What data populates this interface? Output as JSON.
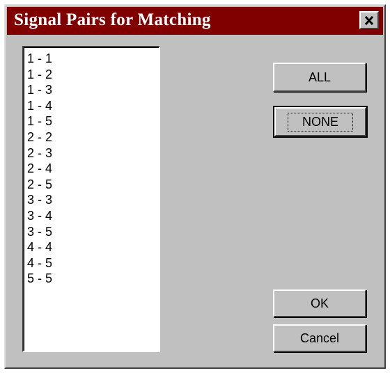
{
  "window": {
    "title": "Signal Pairs for Matching"
  },
  "titlebar": {
    "close_icon": "close-x-icon"
  },
  "signal_pairs": {
    "items": [
      "1 - 1",
      "1 - 2",
      "1 - 3",
      "1 - 4",
      "1 - 5",
      "2 - 2",
      "2 - 3",
      "2 - 4",
      "2 - 5",
      "3 - 3",
      "3 - 4",
      "3 - 5",
      "4 - 4",
      "4 - 5",
      "5 - 5"
    ]
  },
  "buttons": {
    "all": "ALL",
    "none": "NONE",
    "ok": "OK",
    "cancel": "Cancel"
  },
  "colors": {
    "titlebar": "#800000",
    "face": "#c0c0c0",
    "list_bg": "#ffffff"
  }
}
